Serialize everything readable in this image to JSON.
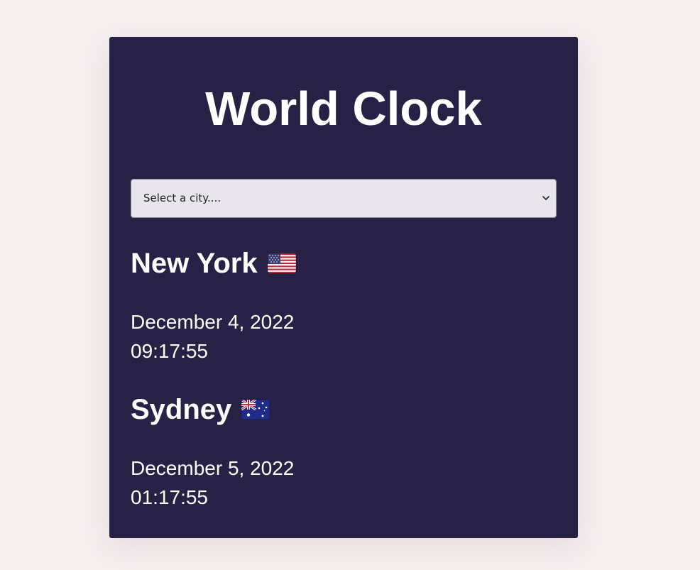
{
  "app": {
    "title": "World Clock"
  },
  "select": {
    "value": "Select a city....",
    "icon": "chevron-down-icon"
  },
  "cities": [
    {
      "name": "New York",
      "flag_icon": "us-flag-icon",
      "date": "December 4, 2022",
      "time": "09:17:55"
    },
    {
      "name": "Sydney",
      "flag_icon": "australia-flag-icon",
      "date": "December 5, 2022",
      "time": "01:17:55"
    }
  ],
  "colors": {
    "page_background": "#f4eeef",
    "card_background": "#282146",
    "text": "#ffffff",
    "select_background": "#e8e6ec"
  }
}
